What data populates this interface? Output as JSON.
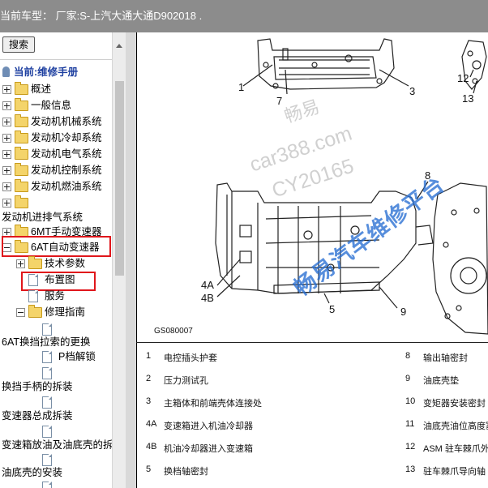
{
  "header": {
    "title": "当前车型：  厂家:S-上汽大通大通D902018   ."
  },
  "search": {
    "button_label": "搜索"
  },
  "tree": {
    "root": "当前:维修手册",
    "items": [
      "概述",
      "一般信息",
      "发动机机械系统",
      "发动机冷却系统",
      "发动机电气系统",
      "发动机控制系统",
      "发动机燃油系统",
      "",
      "发动机进排气系统",
      "6MT手动变速器",
      "6AT自动变速器",
      "技术参数",
      "布置图",
      "服务",
      "修理指南",
      "6AT换挡拉索的更换",
      "P档解锁",
      "换挡手柄的拆装",
      "变速器总成拆装",
      "变速箱放油及油底壳的拆",
      "油底壳的安装"
    ]
  },
  "figure": {
    "code": "GS080007",
    "callouts": [
      "1",
      "7",
      "3",
      "12",
      "13",
      "8",
      "4A",
      "4B",
      "5",
      "9"
    ],
    "watermarks": [
      "畅易",
      "car388.com",
      "CY20165",
      "畅易汽车维修平台"
    ]
  },
  "legend": [
    {
      "num": "1",
      "text": "电控插头护套"
    },
    {
      "num": "8",
      "text": "输出轴密封"
    },
    {
      "num": "2",
      "text": "压力测试孔"
    },
    {
      "num": "9",
      "text": "油底壳垫"
    },
    {
      "num": "3",
      "text": "主箱体和前端壳体连接处"
    },
    {
      "num": "10",
      "text": "变矩器安装密封"
    },
    {
      "num": "4A",
      "text": "变速箱进入机油冷却器"
    },
    {
      "num": "11",
      "text": "油底壳油位高度塞"
    },
    {
      "num": "4B",
      "text": "机油冷却器进入变速箱"
    },
    {
      "num": "12",
      "text": "ASM 驻车棘爪外部"
    },
    {
      "num": "5",
      "text": "换档轴密封"
    },
    {
      "num": "13",
      "text": "驻车棘爪导向轴"
    }
  ],
  "colors": {
    "highlight": "#e0161b",
    "topbar": "#8c8c8c",
    "watermark_blue": "#286ed2"
  }
}
